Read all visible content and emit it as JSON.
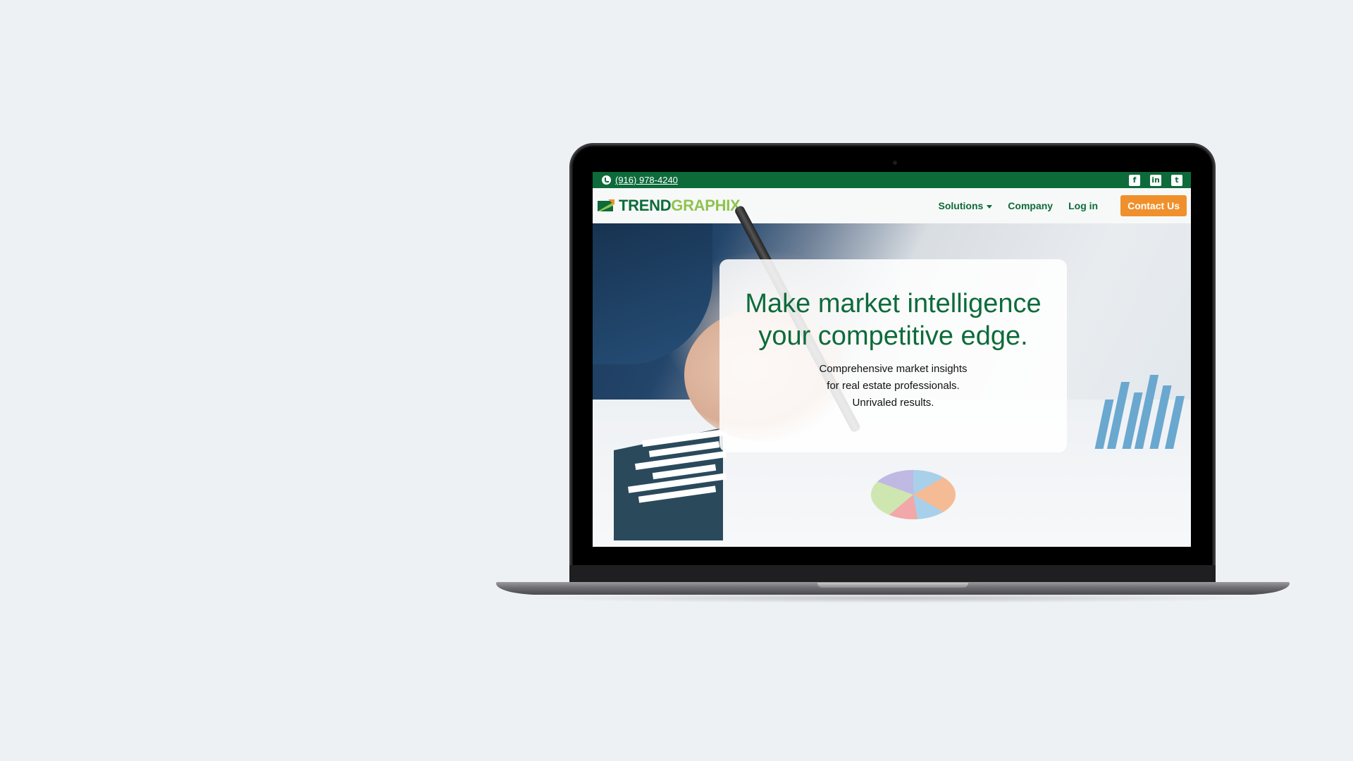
{
  "topbar": {
    "phone": "(916) 978-4240",
    "socials": [
      {
        "icon": "facebook-icon",
        "glyph": "f"
      },
      {
        "icon": "linkedin-icon",
        "glyph": "in"
      },
      {
        "icon": "twitter-icon",
        "glyph": "t"
      }
    ]
  },
  "brand": {
    "part1": "TREND",
    "part2": "GRAPHIX"
  },
  "nav": {
    "solutions": "Solutions",
    "company": "Company",
    "login": "Log in",
    "contact": "Contact Us"
  },
  "hero": {
    "title_line1": "Make market intelligence",
    "title_line2": "your competitive edge.",
    "sub_line1": "Comprehensive market insights",
    "sub_line2": "for real estate professionals.",
    "sub_line3": "Unrivaled results."
  },
  "colors": {
    "brand_green": "#0d6b3a",
    "brand_light_green": "#8fc350",
    "accent_orange": "#f0902c",
    "page_background": "#eef1f4"
  }
}
